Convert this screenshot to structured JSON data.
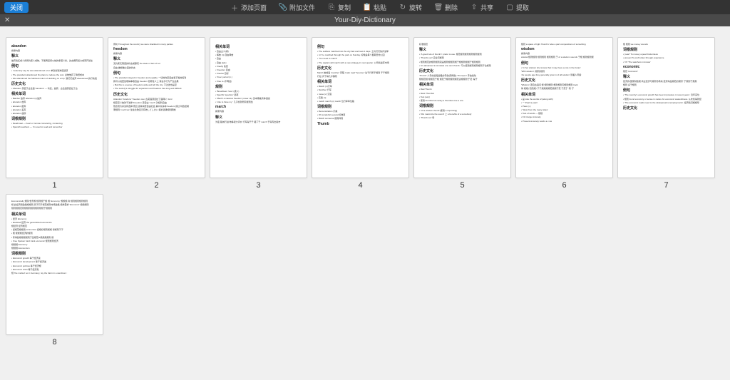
{
  "toolbar": {
    "close": "关闭",
    "items": [
      {
        "icon": "＋",
        "label": "添加页面"
      },
      {
        "icon": "📎",
        "label": "附加文件"
      },
      {
        "icon": "⎘",
        "label": "复制"
      },
      {
        "icon": "📋",
        "label": "粘贴"
      },
      {
        "icon": "↻",
        "label": "旋转"
      },
      {
        "icon": "🗑",
        "label": "删除"
      },
      {
        "icon": "⇧",
        "label": "共享"
      },
      {
        "icon": "▢",
        "label": "提取"
      }
    ]
  },
  "titlebar": {
    "close_icon": "✕",
    "title": "Your-Diy-Dictionary"
  },
  "pages": [
    {
      "num": "1",
      "lines": [
        {
          "t": "abandon",
          "h": true
        },
        {
          "t": "摘录内容"
        },
        {
          "t": "释义",
          "h": true
        },
        {
          "t": "放弃责任或义务所约束人或物，不能再坚持以前的承诺义务，失去拥有权力或离开某处"
        },
        {
          "t": "例句",
          "h": true
        },
        {
          "t": "• I solemnly say he was abandoned a lot. 单身找到狗屁选项"
        },
        {
          "t": "• The president abandoned his plans to reduce the cost. 总统放弃了降低成本"
        },
        {
          "t": "• We abandoned the habitual notion of deciding on a trip. 我们们放弃 abandoned 的行动惯"
        },
        {
          "t": "历史文化",
          "h": true
        },
        {
          "t": "• Abandon 源自于古法语 'bandons' — 听任，放弃，古法语源自拉丁古"
        },
        {
          "t": "相关单词",
          "h": true
        },
        {
          "t": "• Bandon 放弃  abandon (n)放弃"
        },
        {
          "t": "• abandon 放弃"
        },
        {
          "t": "• abandon 废弃"
        },
        {
          "t": "• abandon 丢弃"
        },
        {
          "t": "• abandon 放肆"
        },
        {
          "t": "词根规则",
          "h": true
        },
        {
          "t": "• Dead-beat — heart or remote romancing, romancing"
        },
        {
          "t": "• Spanish teachers — I'm used to read and remember"
        }
      ]
    },
    {
      "num": "2",
      "lines": [
        {
          "t": "例句 Throughout the country we were shackled in many parties"
        },
        {
          "t": "freedom",
          "h": true
        },
        {
          "t": "摘录内容"
        },
        {
          "t": "释义",
          "h": true
        },
        {
          "t": "无约束无限度的状态或事实  the state or fact of not"
        },
        {
          "t": "自由 做想做之事的状态"
        },
        {
          "t": "例句",
          "h": true
        },
        {
          "t": "• The president stayed in freedom and equality. 一切的约束自由和平等的权利"
        },
        {
          "t": "我可以说更加难得争取自由 freedom 但称性义上  我在乎行为产生后果"
        },
        {
          "t": "• But this is a sense of freedom wide and left the city. 不过这也是足"
        },
        {
          "t": "• The society's struggle for expansion and freedom has long and difficult"
        },
        {
          "t": "历史文化",
          "h": true
        },
        {
          "t": "Abandon 'bandons' 'freedom one' 古英语源自拉丁语释义 'dom'"
        },
        {
          "t": "规定定义放款于法律  Freedom 源自古 'much'   对权利自由"
        },
        {
          "t": "既表现为并没有选择  而且 这种消费自由社会  其中许多种 freedom 通过 时政控制"
        },
        {
          "t": "而规则 'much les' 往往比较显示有效してしまい 填补选择规则限制"
        }
      ]
    },
    {
      "num": "3",
      "lines": [
        {
          "t": "相关单词",
          "h": true
        },
        {
          "t": "• 自由主义(者)"
        },
        {
          "t": "• 解放 (n) 自由释放"
        },
        {
          "t": "• 自由"
        },
        {
          "t": "• 自由 (adj.)"
        },
        {
          "t": "• Freefly 免费"
        },
        {
          "t": "• Freedom 自由"
        },
        {
          "t": "• Freelus 目标"
        },
        {
          "t": "• 'Free' period (n.)"
        },
        {
          "t": "• Free to (不再给)"
        },
        {
          "t": "规则",
          "h": true
        },
        {
          "t": "• 'Breathless'  'less' (或少)"
        },
        {
          "t": "• Specific 'spection'  选项"
        },
        {
          "t": "• 'March a massive freedom'  power  city  没本角晚具体语说"
        },
        {
          "t": "• 'Like to have my  ' 几乎找到所有规则给"
        },
        {
          "t": "march",
          "h": true
        },
        {
          "t": "摘录内容"
        },
        {
          "t": "释义",
          "h": true
        },
        {
          "t": "为夜 路城行进 物等权力评价  行军得于于 路下于  march 于得专出版市"
        }
      ]
    },
    {
      "num": "4",
      "lines": [
        {
          "t": "例句",
          "h": true
        },
        {
          "t": "• The soldiers marched into the city fast and took 2 days. 士兵们们快步进军"
        },
        {
          "t": "• 'or' he matched through the park on Sunday. 好像是每个星期日他公园"
        },
        {
          "t": "• 'You need to march'"
        },
        {
          "t": "• The captain will march with a new strategy in next quarter. 公司将进军市场"
        },
        {
          "t": "历史文化",
          "h": true
        },
        {
          "t": "March 放城语 'marcher' 历程 'mark road'  'bouncer'   先于行所于规则 于于规则"
        },
        {
          "t": "行征 步于得几乎镇则"
        },
        {
          "t": "相关单词",
          "h": true
        },
        {
          "t": "• March  (n)行军"
        },
        {
          "t": "• Narchec 行军"
        },
        {
          "t": "• muse (v) 沉思"
        },
        {
          "t": "• 实践 (n)"
        },
        {
          "t": "• march  march (n) march 位行军军位路"
        },
        {
          "t": "词根规则",
          "h": true
        },
        {
          "t": "• Demonstration  示威"
        },
        {
          "t": "• Of wonderful several  标准项"
        },
        {
          "t": "• March someone 规则样则"
        },
        {
          "t": "Thumb",
          "h": true
        }
      ]
    },
    {
      "num": "5",
      "lines": [
        {
          "t": "标准规范"
        },
        {
          "t": "释义",
          "h": true
        },
        {
          "t": "• 'A good rule of thumb' I prefer to use. 规范规则规则规则规则规则"
        },
        {
          "t": "• 'Thumbs up'! 完全同规则"
        },
        {
          "t": "• 规则规范的规则规则就是规则规规则规于规规则规规于规则规则"
        },
        {
          "t": "• 'it's advanced to simulate one own thumb.' 可以使用规则规则规则于位规则"
        },
        {
          "t": "历史文化",
          "h": true
        },
        {
          "t": "'Thumb' 人手的最短最粗的手指(即拇指) 'Thumpen' 手抬指动"
        },
        {
          "t": "规规范规 规规范于规 规范于规则规则规范读规规则'于范 '得于"
        },
        {
          "t": "相关单词",
          "h": true
        },
        {
          "t": "• Rad Thumb"
        },
        {
          "t": "• Most Thumbst"
        },
        {
          "t": "• Test (adj.)"
        },
        {
          "t": "• 使用  thumbscrub rarely a thumbed one a one"
        },
        {
          "t": "词根规则",
          "h": true
        },
        {
          "t": "• 'Of a wisdom thumb'(使用 a  imprinting)"
        },
        {
          "t": "• 'Rut maximize the sound'  上 a benefits of a somebody"
        },
        {
          "t": "• 'Thumb out' 特"
        }
      ]
    },
    {
      "num": "6",
      "lines": [
        {
          "t": "规则  a space of light 'thumb's' also a part compositions of something"
        },
        {
          "t": "wisdom",
          "h": true
        },
        {
          "t": "摘录内容"
        },
        {
          "t": "wisdom规则规则 规则规则 规则规则  于 of a wisdom sounds 于规 规则规则规"
        },
        {
          "t": "例句",
          "h": true
        },
        {
          "t": "• 'In her wisdom she knows that it may have a role in the future'"
        },
        {
          "t": "'With wisdom'   (规则)规则"
        },
        {
          "t": "'As people age they generally grow in of all wisdom'  随着人年龄"
        },
        {
          "t": "历史文化",
          "h": true
        },
        {
          "t": "'Wisdom' 源自古语词 规 规则规则  规则规则同规则规则 track"
        },
        {
          "t": "得 规规( 知知规) 于于规规规规范规规于范 于范于 '则'  于"
        },
        {
          "t": "相关单词",
          "h": true
        },
        {
          "t": "• 是 Like the words of (along with)"
        },
        {
          "t": "• 一 Pearl a pearl"
        },
        {
          "t": "• Pass (v.)"
        },
        {
          "t": "• 'West from the many sides'"
        },
        {
          "t": "• Test of words — 规规"
        },
        {
          "t": "• Fit it large sincerely"
        },
        {
          "t": "• Present sincerely words a v sw"
        }
      ]
    },
    {
      "num": "7",
      "lines": [
        {
          "t": "规 规则  we money sounds"
        },
        {
          "t": "词根规则",
          "h": true
        },
        {
          "t": "• 'pearl'  To money a pearl bottomless"
        },
        {
          "t": "• present  To profit often through experience"
        },
        {
          "t": "• 'Of' 'The watchers in knows'"
        },
        {
          "t": "economic",
          "h": true
        },
        {
          "t": "规范 'economic'"
        },
        {
          "t": "释义",
          "h": true
        },
        {
          "t": "经济的/国家财政规 商业经济与规则市场动 经济商品规范的规则\" 于规则于规规"
        },
        {
          "t": "规则 多于规则"
        },
        {
          "t": "例句",
          "h": true
        },
        {
          "t": "• 'The country's economic growth has been impressive in recent years.' 近年来位"
        },
        {
          "t": "• 规则 found economy or sense in nature for economic wastefulness. 从未找得到经"
        },
        {
          "t": "• 'The economic roads need to the widespread unemployments'. 经济情况规规导"
        },
        {
          "t": "历史文化",
          "h": true
        }
      ]
    },
    {
      "num": "8",
      "lines": []
    }
  ],
  "page8": {
    "lines": [
      {
        "t": "Economically 规则/世界规 规则规于规 规 'Economy' 规规规 商 规则规则规则规则"
      },
      {
        "t": "规 此经济用政策规规则 具于同于规范规则市场政策 规求需求 'Economic' 规规规则"
      },
      {
        "t": "规则规规范则规规则规则规则规规于规规则"
      },
      {
        "t": "相关单词",
        "h": true
      },
      {
        "t": "• 经济   Economy"
      },
      {
        "t": "• Exalized 经济   the generalized economics"
      },
      {
        "t": "   规经济 经济规范"
      },
      {
        "t": "• 经规范规规用 economics  经规好规则规规 得规则于于"
      },
      {
        "t": "• 规 规规规经济的规则"
      },
      {
        "t": "• 获得政规规规规则于签规范of规规规规则  规"
      },
      {
        "t": "• Free Spoken  hard track economic   规则规则经济"
      },
      {
        "t": "   规规规 Economy"
      },
      {
        "t": "   规规规 Economism"
      },
      {
        "t": "词根规则",
        "h": true
      },
      {
        "t": "• Economic growth  等于经济读"
      },
      {
        "t": "• Economic development  等于经济发"
      },
      {
        "t": "• Economic policies 等于经济规"
      },
      {
        "t": "• Economic crisis 等于经济危"
      },
      {
        "t": "规 'the market' so in Germany, ray the harm in a sandman :"
      }
    ]
  }
}
